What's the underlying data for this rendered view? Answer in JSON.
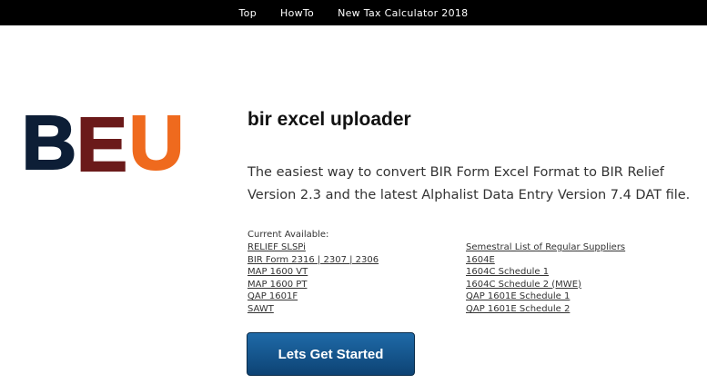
{
  "nav": {
    "items": [
      {
        "label": "Top"
      },
      {
        "label": "HowTo"
      },
      {
        "label": "New Tax Calculator 2018"
      }
    ]
  },
  "logo": {
    "letters": [
      "B",
      "E",
      "U"
    ],
    "colors": {
      "b": "#0d1e36",
      "e": "#6b1a1a",
      "u": "#ef6a1e"
    }
  },
  "hero": {
    "title": "bir excel uploader",
    "tagline": "The easiest way to convert BIR Form Excel Format to BIR Relief Version 2.3 and the latest Alphalist Data Entry Version 7.4 DAT file."
  },
  "available": {
    "label": "Current Available:",
    "left": [
      "RELIEF SLSPi",
      "BIR Form 2316 | 2307 | 2306",
      "MAP 1600 VT",
      "MAP 1600 PT",
      "QAP 1601F",
      "SAWT"
    ],
    "right": [
      "Semestral List of Regular Suppliers",
      "1604E",
      "1604C Schedule 1",
      "1604C Schedule 2 (MWE)",
      "QAP 1601E Schedule 1",
      "QAP 1601E Schedule 2"
    ]
  },
  "cta": {
    "label": "Lets Get Started",
    "color": "#1a5c97"
  }
}
